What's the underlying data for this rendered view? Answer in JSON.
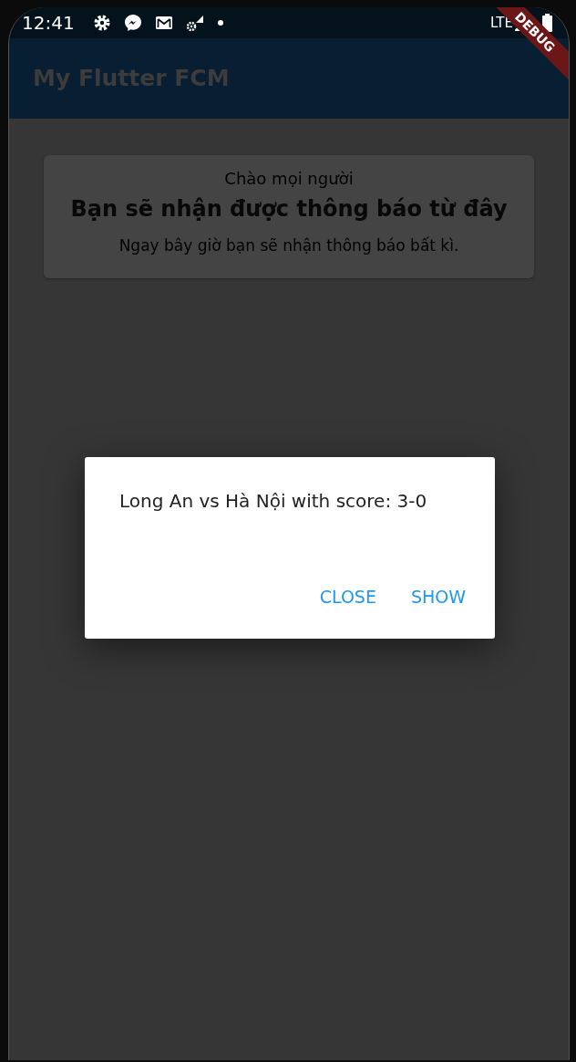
{
  "status_bar": {
    "time": "12:41",
    "network": "LTE"
  },
  "debug_banner": {
    "label": "DEBUG"
  },
  "app_bar": {
    "title": "My Flutter FCM"
  },
  "card": {
    "greeting": "Chào mọi người",
    "heading": "Bạn sẽ nhận được thông báo từ đây",
    "body": "Ngay bây giờ bạn sẽ nhận thông báo bất kì."
  },
  "dialog": {
    "message": "Long An vs Hà Nội with score: 3-0",
    "actions": [
      {
        "label": "CLOSE"
      },
      {
        "label": "SHOW"
      }
    ]
  }
}
